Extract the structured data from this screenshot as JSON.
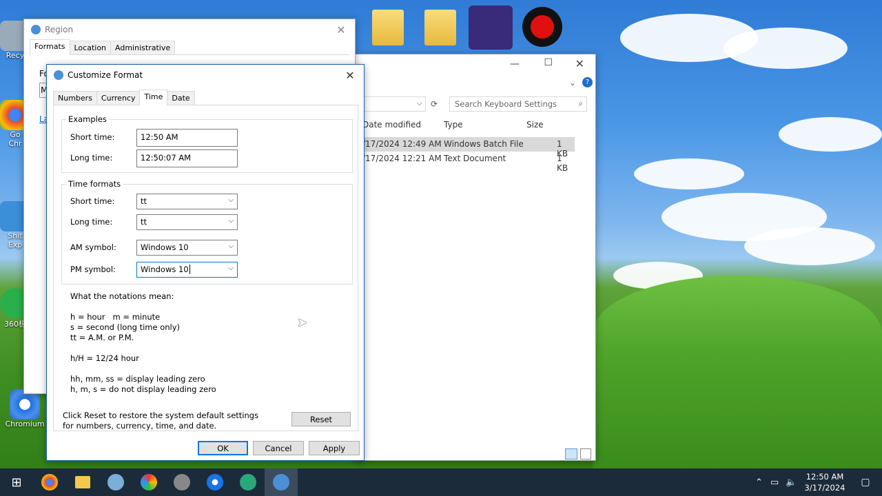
{
  "desktop": {
    "icons": [
      {
        "label": "Recy",
        "name": "recycle-bin"
      },
      {
        "label": "Go\nChr",
        "name": "chrome"
      },
      {
        "label": "Shit\nExp",
        "name": "explorer"
      },
      {
        "label": "360极",
        "name": "360-browser"
      },
      {
        "label": "Chromium",
        "name": "chromium"
      }
    ]
  },
  "region": {
    "title": "Region",
    "tabs": [
      "Formats",
      "Location",
      "Administrative"
    ],
    "partial_text": [
      "Fo",
      "M",
      "La"
    ]
  },
  "explorer": {
    "search_placeholder": "Search Keyboard Settings",
    "columns": [
      "Date modified",
      "Type",
      "Size"
    ],
    "rows": [
      {
        "date": "/17/2024 12:49 AM",
        "type": "Windows Batch File",
        "size": "1 KB"
      },
      {
        "date": "/17/2024 12:21 AM",
        "type": "Text Document",
        "size": "1 KB"
      }
    ]
  },
  "dialog": {
    "title": "Customize Format",
    "tabs": [
      "Numbers",
      "Currency",
      "Time",
      "Date"
    ],
    "active_tab": "Time",
    "examples": {
      "title": "Examples",
      "short_label": "Short time:",
      "short_value": "12:50 AM",
      "long_label": "Long time:",
      "long_value": "12:50:07 AM"
    },
    "formats": {
      "title": "Time formats",
      "short_label": "Short time:",
      "short_value": "tt",
      "long_label": "Long time:",
      "long_value": "tt",
      "am_label": "AM symbol:",
      "am_value": "Windows 10",
      "pm_label": "PM symbol:",
      "pm_value": "Windows 10"
    },
    "notes": {
      "heading": "What the notations mean:",
      "line1": "h = hour   m = minute",
      "line2": "s = second (long time only)",
      "line3": "tt = A.M. or P.M.",
      "line4": "h/H = 12/24 hour",
      "line5": "hh, mm, ss = display leading zero",
      "line6": "h, m, s = do not display leading zero"
    },
    "reset_text": "Click Reset to restore the system default settings for numbers, currency, time, and date.",
    "reset_label": "Reset",
    "ok_label": "OK",
    "cancel_label": "Cancel",
    "apply_label": "Apply"
  },
  "taskbar": {
    "time": "12:50 AM",
    "date": "3/17/2024"
  },
  "colors": {
    "accent": "#0078d7",
    "taskbar": "#1c2b3a"
  }
}
